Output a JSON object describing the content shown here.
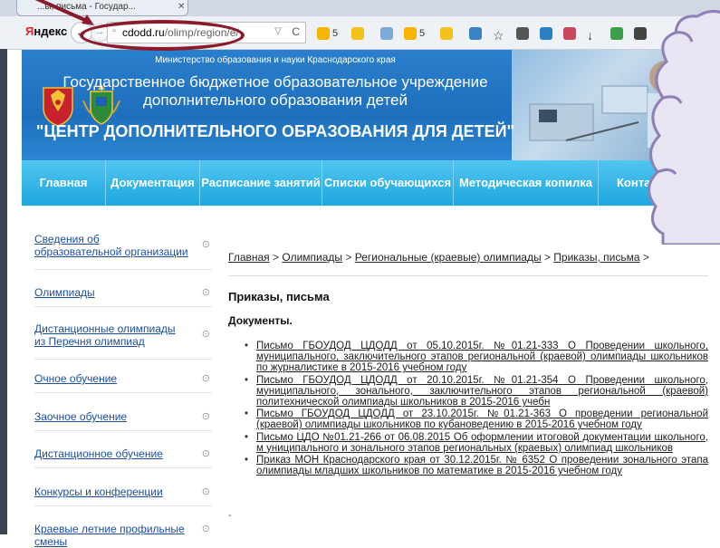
{
  "browser": {
    "tab_title": "...ы, письма - Государ...",
    "tab_close": "✕",
    "brand": "Яндекс",
    "back_icon": "←",
    "forward_icon": "→",
    "url_host": "cdodd.ru",
    "url_path": "/olimp/region/e/",
    "dropdown_glyph": "▽",
    "reload_glyph": "C",
    "extensions": [
      {
        "icon": "weather-icon",
        "label": "5",
        "color": "#f5b400"
      },
      {
        "icon": "mail-icon",
        "label": "",
        "color": "#f2c21b"
      },
      {
        "icon": "page-icon",
        "label": "",
        "color": "#7da9d6"
      },
      {
        "icon": "weather-icon",
        "label": "5",
        "color": "#f5b400"
      },
      {
        "icon": "mail-icon",
        "label": "",
        "color": "#f2c21b"
      },
      {
        "icon": "rocket-icon",
        "label": "",
        "color": "#3a82c4"
      },
      {
        "icon": "star-icon",
        "label": "☆",
        "color": "#444"
      },
      {
        "icon": "reader-icon",
        "label": "",
        "color": "#555"
      },
      {
        "icon": "p-icon",
        "label": "",
        "color": "#2b7fc4"
      },
      {
        "icon": "pocket-icon",
        "label": "",
        "color": "#c9475a"
      },
      {
        "icon": "download-icon",
        "label": "↓",
        "color": "#333"
      },
      {
        "icon": "green-icon",
        "label": "",
        "color": "#3a9f4a"
      },
      {
        "icon": "smile-icon",
        "label": "",
        "color": "#444"
      }
    ]
  },
  "header": {
    "ministry": "Министерство образования и науки Краснодарского края",
    "institution_line1": "Государственное бюджетное образовательное учреждение",
    "institution_line2": "дополнительного образования детей",
    "center_name": "\"ЦЕНТР ДОПОЛНИТЕЛЬНОГО ОБРАЗОВАНИЯ ДЛЯ ДЕТЕЙ\""
  },
  "nav": [
    "Главная",
    "Документация",
    "Расписание занятий",
    "Списки обучающихся",
    "Методическая копилка",
    "Контакты"
  ],
  "sidebar": [
    "Сведения об образовательной организации",
    "Олимпиады",
    "Дистанционные олимпиады из Перечня олимпиад",
    "Очное обучение",
    "Заочное обучение",
    "Дистанционное обучение",
    "Конкурсы и конференции",
    "Краевые летние профильные смены"
  ],
  "sidebar_arrow": "⊙",
  "breadcrumbs": {
    "items": [
      "Главная",
      "Олимпиады",
      "Региональные (краевые) олимпиады",
      "Приказы, письма"
    ],
    "separator": " > "
  },
  "page_title": "Приказы, письма",
  "docs_label": "Документы.",
  "documents": [
    "Письмо ГБОУДОД ЦДОДД от 05.10.2015г. №01.21-333 О Проведении школьного, муниципального, заключительного этапов региональной (краевой) олимпиады школьников по журналистике в 2015-2016 учебном году",
    "Письмо ГБОУДОД ЦДОДД от 20.10.2015г. №01.21-354 О Проведении школьного, муниципального, зонального, заключительного этапов региональной (краевой) политехнической олимпиады школьников в 2015-2016 учебн",
    "Письмо ГБОУДОД ЦДОДД от 23.10.2015г. №01.21-363 О проведении региональной (краевой) олимпиады школьников по кубановедению в 2015-2016 учебном году",
    "Письмо ЦДО №01.21-266 от 06.08.2015 Об оформлении итоговой документации школьного, м униципального и зонального этапов региональных (краевых) олимпиад школьников",
    "Приказ МОН Краснодарского края от 30.12.2015г. № 6352 О проведении зонального этапа олимпиады младших школьников по математике в 2015-2016 учебном году"
  ],
  "footer_dash": "-"
}
